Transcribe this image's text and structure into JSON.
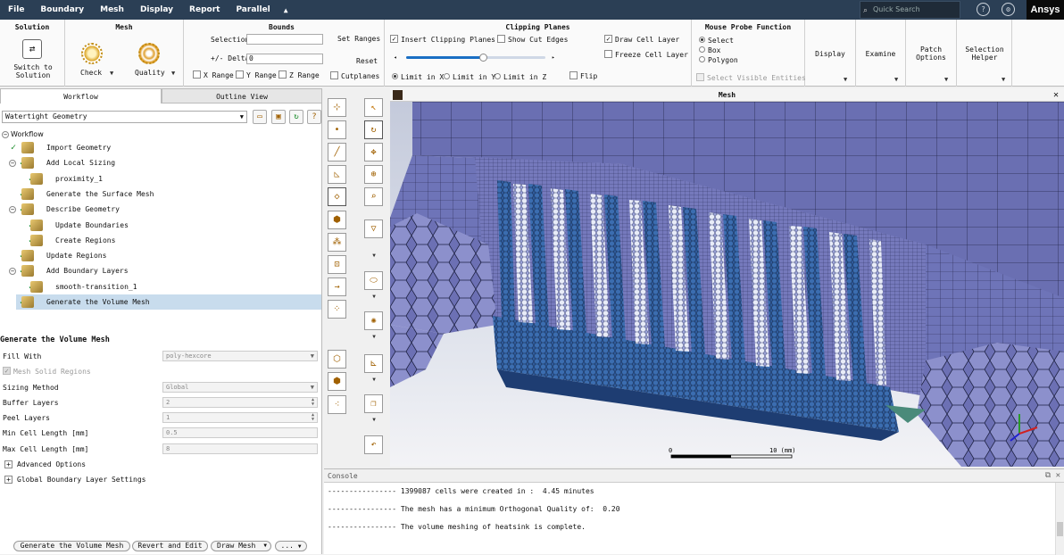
{
  "menubar": {
    "items": [
      "File",
      "Boundary",
      "Mesh",
      "Display",
      "Report",
      "Parallel"
    ],
    "collapse_glyph": "▲",
    "search_placeholder": "Quick Search",
    "help_icon": "?",
    "gear_icon": "⚙",
    "brand": "Ansys"
  },
  "ribbon": {
    "solution": {
      "title": "Solution",
      "button": "Switch to Solution"
    },
    "mesh": {
      "title": "Mesh",
      "check": "Check",
      "quality": "Quality"
    },
    "bounds": {
      "title": "Bounds",
      "selection_label": "Selection",
      "delta_label": "+/- Delta",
      "delta_value": "0",
      "set_ranges": "Set Ranges",
      "reset": "Reset",
      "x_range": "X Range",
      "y_range": "Y Range",
      "z_range": "Z Range",
      "cutplanes": "Cutplanes"
    },
    "clipping": {
      "title": "Clipping Planes",
      "insert": "Insert Clipping Planes",
      "show_cut_edges": "Show Cut Edges",
      "draw_cell_layer": "Draw Cell Layer",
      "freeze_cell_layer": "Freeze Cell Layer",
      "limit_x": "Limit in X",
      "limit_y": "Limit in Y",
      "limit_z": "Limit in Z",
      "flip": "Flip",
      "slider_value": 0.55
    },
    "mouse_probe": {
      "title": "Mouse Probe Function",
      "select": "Select",
      "box": "Box",
      "polygon": "Polygon",
      "show_visible": "Select Visible Entities"
    },
    "display": "Display",
    "examine": "Examine",
    "patch_options": "Patch Options",
    "selection_helper": "Selection Helper"
  },
  "left": {
    "tabs": [
      "Workflow",
      "Outline View"
    ],
    "workflow_type": "Watertight Geometry",
    "tree_root": "Workflow",
    "tree": [
      {
        "label": "Import Geometry"
      },
      {
        "label": "Add Local Sizing"
      },
      {
        "label": "proximity_1"
      },
      {
        "label": "Generate the Surface Mesh"
      },
      {
        "label": "Describe Geometry"
      },
      {
        "label": "Update Boundaries"
      },
      {
        "label": "Create Regions"
      },
      {
        "label": "Update Regions"
      },
      {
        "label": "Add Boundary Layers"
      },
      {
        "label": "smooth-transition_1"
      },
      {
        "label": "Generate the Volume Mesh"
      }
    ],
    "task_title": "Generate the Volume Mesh",
    "props": [
      {
        "label": "Fill With",
        "value": "poly-hexcore"
      },
      {
        "label": "Mesh Solid Regions",
        "value": ""
      },
      {
        "label": "Sizing Method",
        "value": "Global"
      },
      {
        "label": "Buffer Layers",
        "value": "2"
      },
      {
        "label": "Peel Layers",
        "value": "1"
      },
      {
        "label": "Min Cell Length [mm]",
        "value": "0.5"
      },
      {
        "label": "Max Cell Length [mm]",
        "value": "8"
      }
    ],
    "advanced": "Advanced Options",
    "global_bl": "Global Boundary Layer Settings",
    "buttons": {
      "generate": "Generate the Volume Mesh",
      "revert": "Revert and Edit",
      "draw": "Draw Mesh",
      "more": "..."
    }
  },
  "viewport": {
    "title": "Mesh",
    "scale_start": "0",
    "scale_end": "10 (mm)"
  },
  "console": {
    "title": "Console",
    "lines": [
      "---------------- 1399087 cells were created in :  4.45 minutes",
      "---------------- The mesh has a minimum Orthogonal Quality of:  0.20",
      "---------------- The volume meshing of heatsink is complete."
    ]
  },
  "colors": {
    "menubar": "#2b3f55",
    "mesh_face": "#6a6fb2",
    "mesh_dark": "#2f4f8a",
    "check": "#1a8c2a"
  }
}
